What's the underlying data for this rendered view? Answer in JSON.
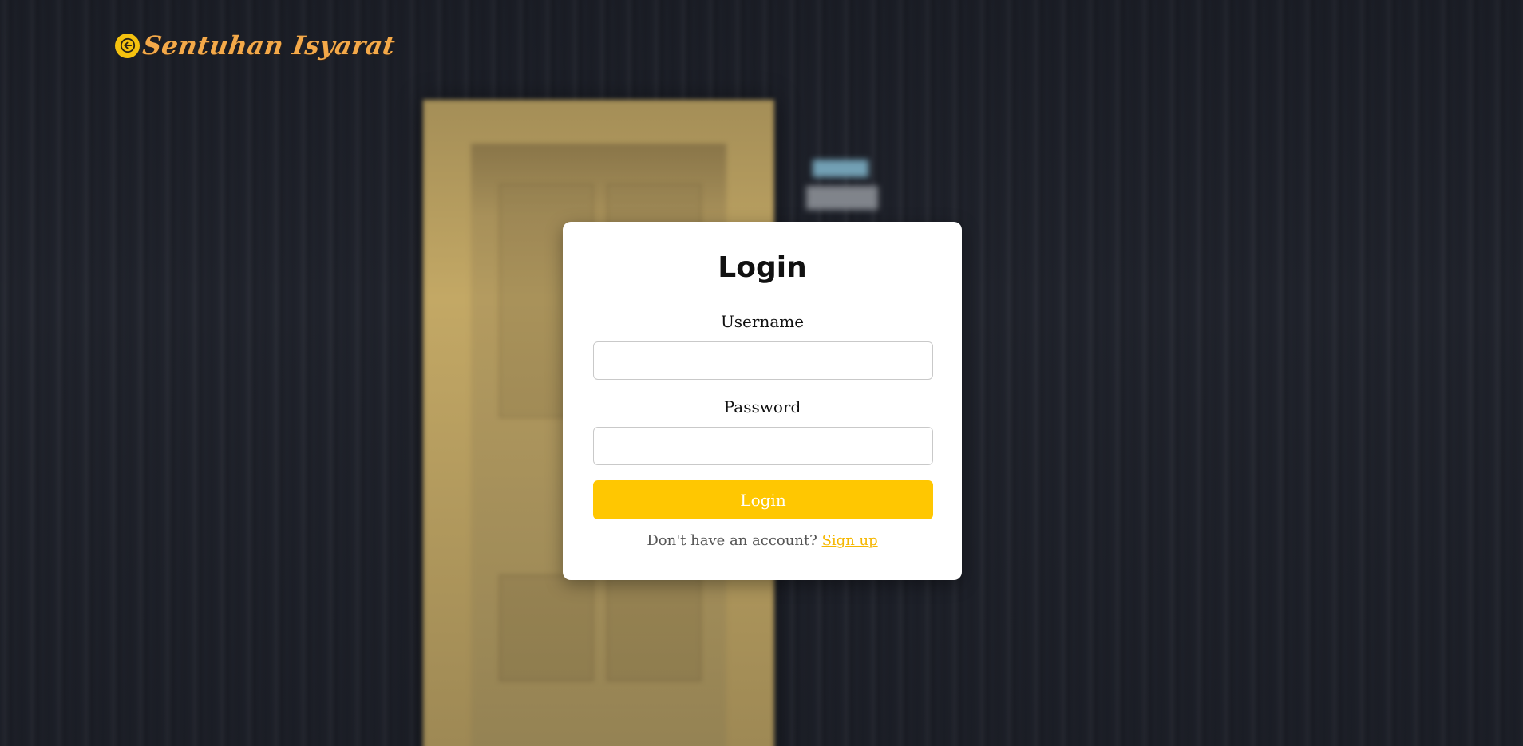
{
  "brand": {
    "name": "Sentuhan Isyarat",
    "back_icon": "arrow-left-circle-icon",
    "accent_color": "#f5c20f"
  },
  "login": {
    "title": "Login",
    "username_label": "Username",
    "username_value": "",
    "password_label": "Password",
    "password_value": "",
    "submit_label": "Login",
    "signup_prompt": "Don't have an account?",
    "signup_link": "Sign up",
    "button_color": "#ffc701"
  }
}
